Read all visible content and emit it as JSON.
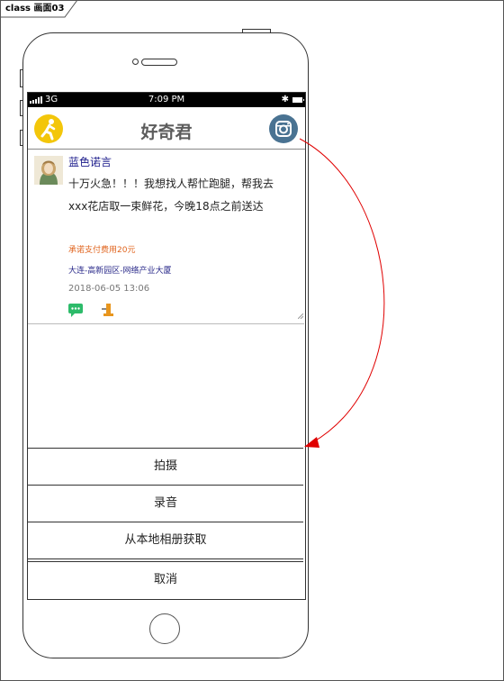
{
  "frame": {
    "label": "class 画面03"
  },
  "statusbar": {
    "carrier": "3G",
    "time": "7:09 PM",
    "bluetooth": "✱"
  },
  "header": {
    "title": "好奇君",
    "left_icon": "runner-icon",
    "right_icon": "instagram-icon"
  },
  "post": {
    "username": "蓝色诺言",
    "body": "十万火急！！！我想找人帮忙跑腿，帮我去xxx花店取一束鲜花，今晚18点之前送达",
    "reward": "承诺支付费用20元",
    "location": "大连-高新园区-网络产业大厦",
    "time": "2018-06-05 13:06"
  },
  "sheet": {
    "items": [
      {
        "label": "拍摄"
      },
      {
        "label": "录音"
      },
      {
        "label": "从本地相册获取"
      }
    ],
    "cancel": "取消"
  },
  "colors": {
    "runner_icon_bg": "#f3c60a",
    "instagram_icon_bg": "#4a7392",
    "reward_text": "#e0641e",
    "username_text": "#1a1a8a",
    "arrow": "#e00000"
  }
}
